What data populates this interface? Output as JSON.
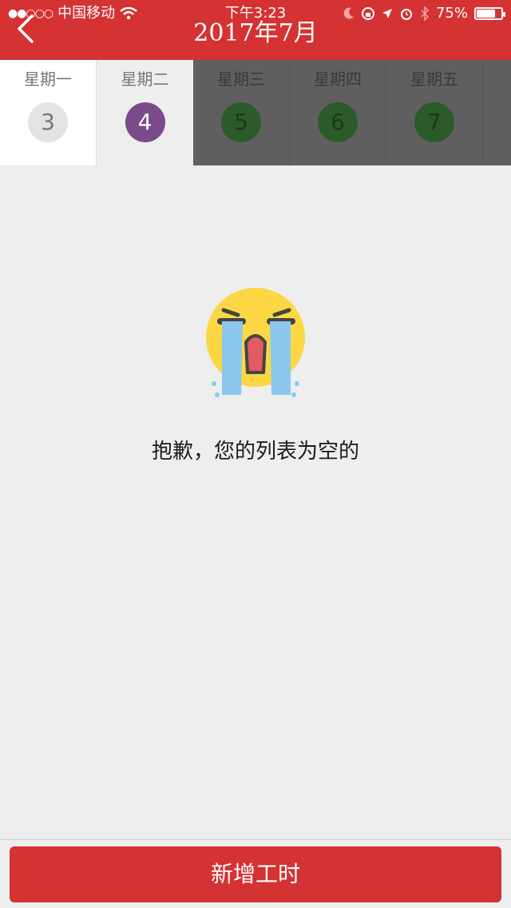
{
  "status_bar": {
    "carrier": "中国移动",
    "time": "下午3:23",
    "battery_percent": "75%",
    "battery_level": 0.75
  },
  "header": {
    "title": "2017年7月",
    "back_icon": "chevron-left-icon",
    "color": "#d43233"
  },
  "week": [
    {
      "name": "星期一",
      "date": "3",
      "state": "normal"
    },
    {
      "name": "星期二",
      "date": "4",
      "state": "selected"
    },
    {
      "name": "星期三",
      "date": "5",
      "state": "disabled"
    },
    {
      "name": "星期四",
      "date": "6",
      "state": "disabled"
    },
    {
      "name": "星期五",
      "date": "7",
      "state": "disabled"
    }
  ],
  "empty_state": {
    "icon": "crying-face-icon",
    "message": "抱歉，您的列表为空的"
  },
  "footer": {
    "add_button_label": "新增工时"
  }
}
